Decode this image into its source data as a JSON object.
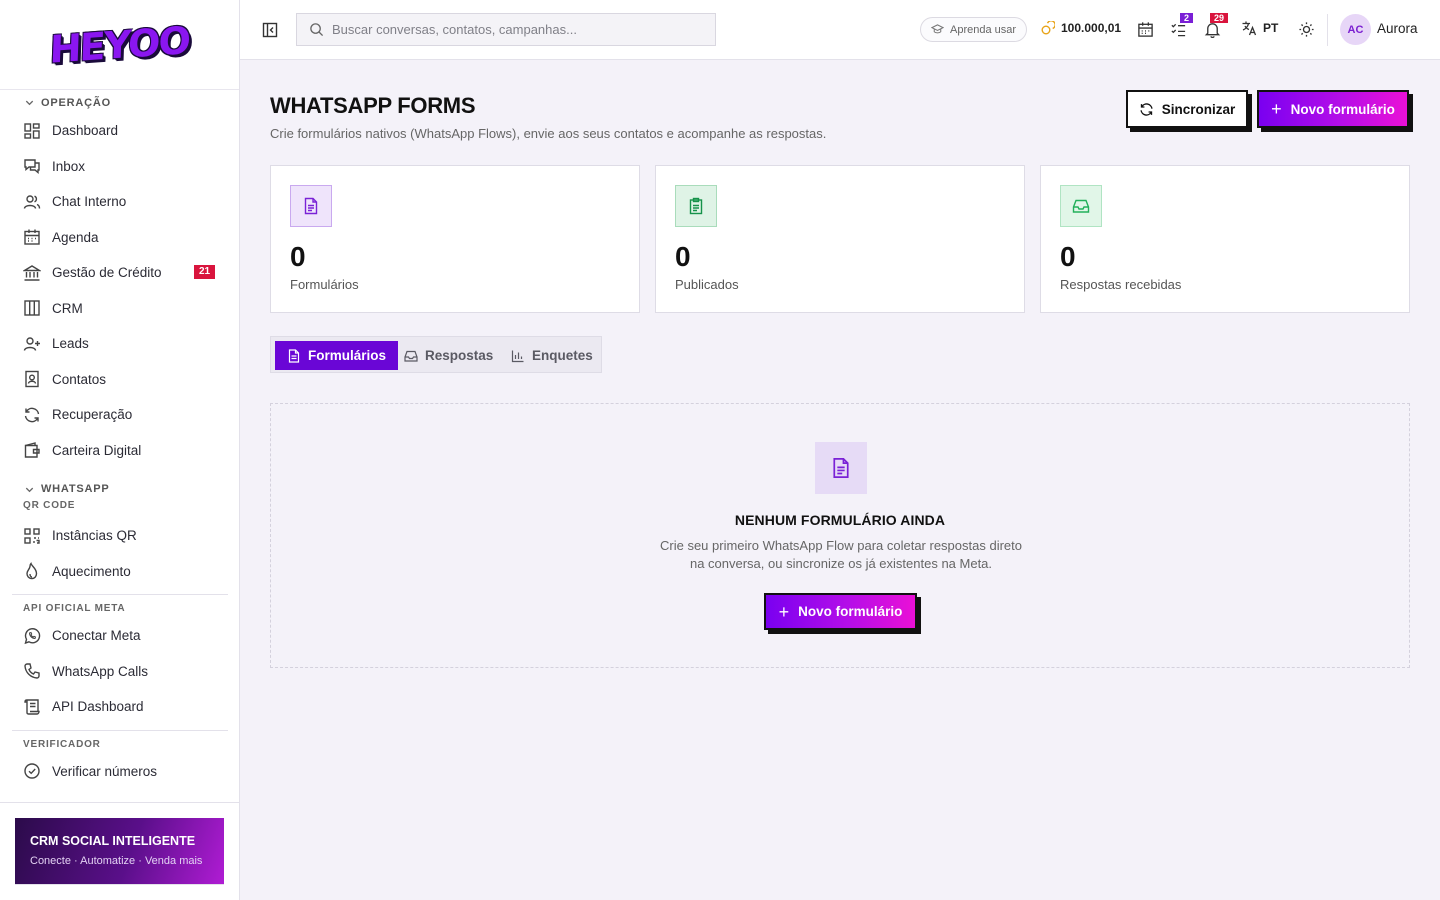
{
  "brand": {
    "logo_text": "HEYOO"
  },
  "sidebar": {
    "sections": [
      {
        "title": "OPERAÇÃO",
        "items": [
          {
            "label": "Dashboard",
            "icon": "dashboard-icon"
          },
          {
            "label": "Inbox",
            "icon": "inbox-icon"
          },
          {
            "label": "Chat Interno",
            "icon": "users-icon"
          },
          {
            "label": "Agenda",
            "icon": "calendar-icon"
          },
          {
            "label": "Gestão de Crédito",
            "icon": "bank-icon",
            "badge": "21"
          },
          {
            "label": "CRM",
            "icon": "kanban-icon"
          },
          {
            "label": "Leads",
            "icon": "user-plus-icon"
          },
          {
            "label": "Contatos",
            "icon": "contact-book-icon"
          },
          {
            "label": "Recuperação",
            "icon": "refresh-icon"
          },
          {
            "label": "Carteira Digital",
            "icon": "wallet-icon"
          }
        ]
      },
      {
        "title": "WHATSAPP",
        "groups": [
          {
            "title": "QR CODE",
            "items": [
              {
                "label": "Instâncias QR",
                "icon": "qr-code-icon"
              },
              {
                "label": "Aquecimento",
                "icon": "flame-icon"
              }
            ]
          },
          {
            "title": "API OFICIAL META",
            "items": [
              {
                "label": "Conectar Meta",
                "icon": "whatsapp-icon"
              },
              {
                "label": "WhatsApp Calls",
                "icon": "phone-icon"
              },
              {
                "label": "API Dashboard",
                "icon": "scroll-icon"
              }
            ]
          },
          {
            "title": "VERIFICADOR",
            "items": [
              {
                "label": "Verificar números",
                "icon": "check-circle-icon"
              }
            ]
          }
        ]
      }
    ],
    "promo": {
      "title": "CRM SOCIAL INTELIGENTE",
      "subtitle": "Conecte · Automatize · Venda mais"
    }
  },
  "topbar": {
    "search_placeholder": "Buscar conversas, contatos, campanhas...",
    "learn_label": "Aprenda usar",
    "coins": "100.000,01",
    "tasks_badge": "2",
    "notifications_badge": "29",
    "language": "PT",
    "avatar_initials": "AC",
    "username": "Aurora"
  },
  "page": {
    "title": "WHATSAPP FORMS",
    "subtitle": "Crie formulários nativos (WhatsApp Flows), envie aos seus contatos e acompanhe as respostas.",
    "sync_label": "Sincronizar",
    "new_form_label": "Novo formulário"
  },
  "stats": [
    {
      "value": "0",
      "label": "Formulários",
      "icon": "document-icon",
      "color": "#7a22d6"
    },
    {
      "value": "0",
      "label": "Publicados",
      "icon": "clipboard-icon",
      "color": "#16924a"
    },
    {
      "value": "0",
      "label": "Respostas recebidas",
      "icon": "inbox-tray-icon",
      "color": "#22b05a"
    }
  ],
  "tabs": [
    {
      "label": "Formulários",
      "active": true
    },
    {
      "label": "Respostas",
      "active": false
    },
    {
      "label": "Enquetes",
      "active": false
    }
  ],
  "empty_state": {
    "title": "NENHUM FORMULÁRIO AINDA",
    "description": "Crie seu primeiro WhatsApp Flow para coletar respostas direto na conversa, ou sincronize os já existentes na Meta.",
    "button_label": "Novo formulário"
  },
  "colors": {
    "accent": "#7a00f0",
    "accent_end": "#ea10d6",
    "badge_red": "#d9143d",
    "badge_purple": "#7a1fd6"
  }
}
